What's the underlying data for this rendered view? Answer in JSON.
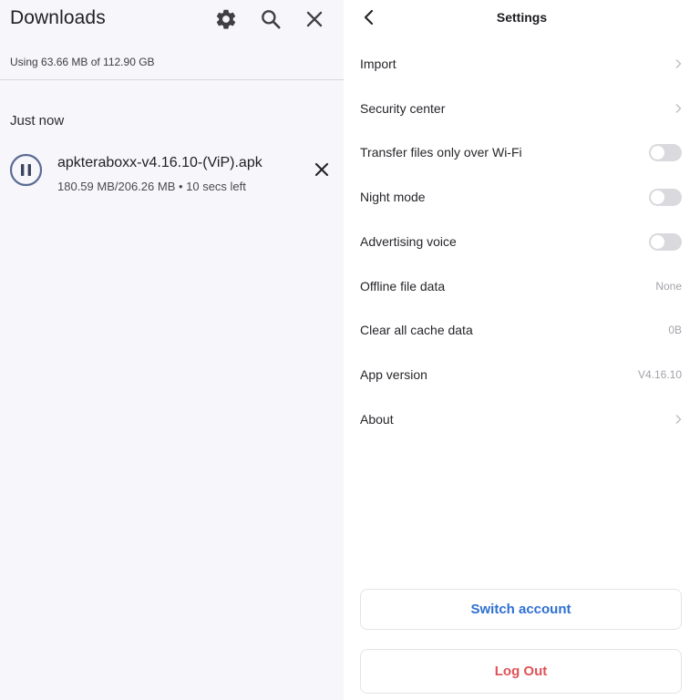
{
  "downloads": {
    "title": "Downloads",
    "storage_text": "Using 63.66 MB of 112.90 GB",
    "section_label": "Just now",
    "item": {
      "file_name": "apkteraboxx-v4.16.10-(ViP).apk",
      "progress_text": "180.59 MB/206.26 MB • 10 secs left",
      "state": "downloading"
    },
    "header_icons": [
      "gear-icon",
      "search-icon",
      "close-icon"
    ],
    "colors": {
      "background": "#f7f6fb",
      "accent": "#5b6b93"
    }
  },
  "settings": {
    "title": "Settings",
    "rows": [
      {
        "label": "Import",
        "control": "chevron"
      },
      {
        "label": "Security center",
        "control": "chevron"
      },
      {
        "label": "Transfer files only over Wi-Fi",
        "control": "toggle",
        "on": false
      },
      {
        "label": "Night mode",
        "control": "toggle",
        "on": false
      },
      {
        "label": "Advertising voice",
        "control": "toggle",
        "on": false
      },
      {
        "label": "Offline file data",
        "control": "value",
        "value": "None"
      },
      {
        "label": "Clear all cache data",
        "control": "value",
        "value": "0B"
      },
      {
        "label": "App version",
        "control": "value",
        "value": "V4.16.10"
      },
      {
        "label": "About",
        "control": "chevron"
      }
    ],
    "switch_account_label": "Switch account",
    "logout_label": "Log Out",
    "colors": {
      "switch": "#2e6fd1",
      "logout": "#e05256"
    }
  }
}
